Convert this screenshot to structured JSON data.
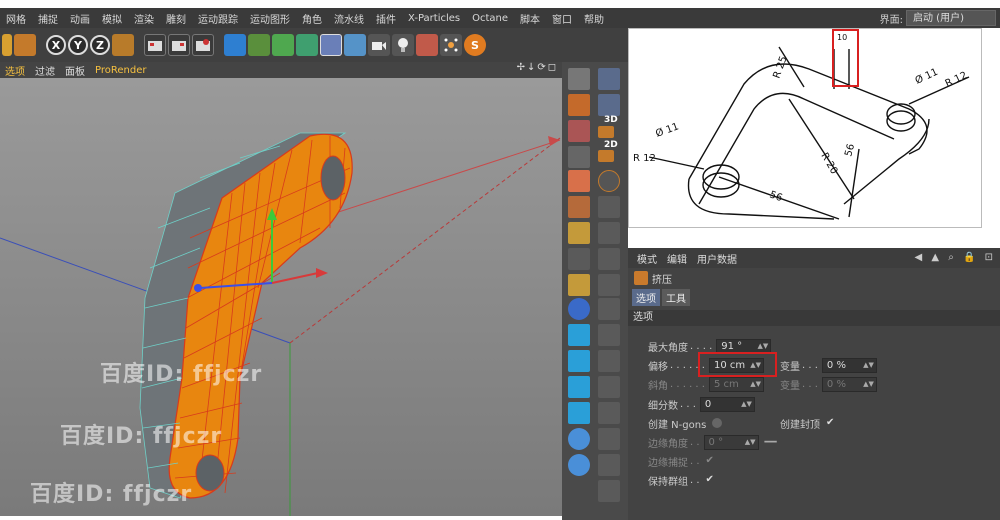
{
  "menubar": {
    "items": [
      "网格",
      "捕捉",
      "动画",
      "模拟",
      "渲染",
      "雕刻",
      "运动跟踪",
      "运动图形",
      "角色",
      "流水线",
      "插件",
      "X-Particles",
      "Octane",
      "脚本",
      "窗口",
      "帮助"
    ],
    "layout_label": "界面:",
    "layout_value": "启动 (用户)"
  },
  "toolbar": {
    "axis_x": "X",
    "axis_y": "Y",
    "axis_z": "Z"
  },
  "viewport_menu": {
    "items": [
      "选项",
      "过滤",
      "面板",
      "ProRender"
    ],
    "nav_icons": "✢↓⟳◻"
  },
  "left_strip": {
    "labels": [
      "3D",
      "2D"
    ]
  },
  "reference_drawing": {
    "label_top": "10",
    "label_r25": "R 25",
    "label_d11_right": "Ø 11",
    "label_r12_right": "R 12",
    "label_d11_left": "Ø 11",
    "label_r12_left": "R 12",
    "label_r20": "R 20",
    "label_56_right": "56",
    "label_56_bottom": "56"
  },
  "attributes": {
    "menu": [
      "模式",
      "编辑",
      "用户数据"
    ],
    "object_name": "挤压",
    "tabs": [
      "选项",
      "工具"
    ],
    "section": "选项",
    "fields": {
      "max_angle_label": "最大角度",
      "max_angle_value": "91 °",
      "offset_label": "偏移",
      "offset_value": "10 cm",
      "variance_label": "变量",
      "variance_value": "0 %",
      "bevel_label": "斜角",
      "bevel_value": "5 cm",
      "variance2_label": "变量",
      "variance2_value": "0 %",
      "subdiv_label": "细分数",
      "subdiv_value": "0",
      "ngons_label": "创建 N-gons",
      "create_caps_label": "创建封顶",
      "edge_angle_label": "边缘角度",
      "edge_angle_value": "0 °",
      "edge_snap_label": "边缘捕捉",
      "keep_groups_label": "保持群组"
    }
  },
  "watermarks": [
    "百度ID: ffjczr",
    "百度ID: ffjczr",
    "百度ID: ffjczr"
  ],
  "colors": {
    "mesh_orange": "#e8860f",
    "wire_red": "#d83a1c",
    "highlight_red": "#d82020"
  }
}
